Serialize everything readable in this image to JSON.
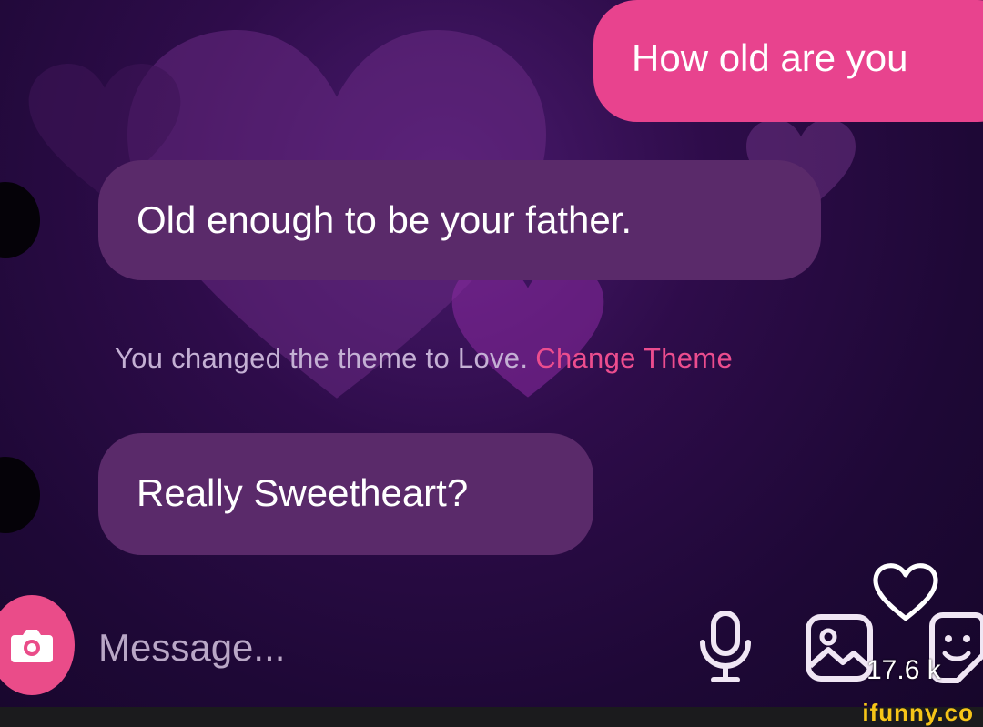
{
  "messages": {
    "outgoing_1": "How old are you",
    "incoming_1": "Old enough to be your father.",
    "incoming_2": "Really Sweetheart?"
  },
  "system_notice": {
    "text": "You changed the theme to Love.",
    "link_label": "Change Theme"
  },
  "composer": {
    "placeholder": "Message..."
  },
  "overlay": {
    "like_count": "17.6 k"
  },
  "watermark": {
    "brand": "ifunny.co"
  },
  "icons": {
    "camera": "camera-icon",
    "mic": "microphone-icon",
    "gallery": "image-icon",
    "sticker": "sticker-icon",
    "like": "heart-icon"
  },
  "colors": {
    "outgoing_bubble": "#e8438e",
    "incoming_bubble": "#5a2a6a",
    "accent_link": "#ec4d8e",
    "camera_button": "#ea4c89",
    "background": "#1e0836",
    "brand": "#f5c518"
  }
}
